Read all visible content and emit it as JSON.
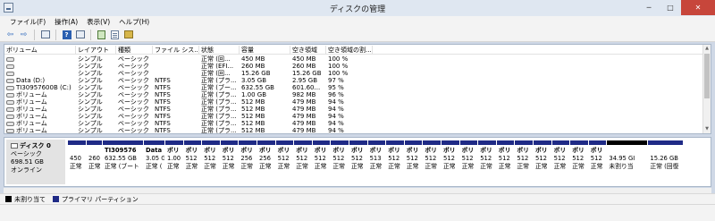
{
  "window": {
    "title": "ディスクの管理",
    "minimize": "─",
    "maximize": "□",
    "close": "✕"
  },
  "menu": [
    "ファイル(F)",
    "操作(A)",
    "表示(V)",
    "ヘルプ(H)"
  ],
  "toolbar": {
    "back": "⇦",
    "forward": "⇨"
  },
  "columns": [
    "ボリューム",
    "レイアウト",
    "種類",
    "ファイル シス...",
    "状態",
    "容量",
    "空き領域",
    "空き領域の割..."
  ],
  "volumes": [
    [
      "",
      "シンプル",
      "ベーシック",
      "",
      "正常 (回...",
      "450 MB",
      "450 MB",
      "100 %"
    ],
    [
      "",
      "シンプル",
      "ベーシック",
      "",
      "正常 (EFI...",
      "260 MB",
      "260 MB",
      "100 %"
    ],
    [
      "",
      "シンプル",
      "ベーシック",
      "",
      "正常 (回...",
      "15.26 GB",
      "15.26 GB",
      "100 %"
    ],
    [
      "Data (D:)",
      "シンプル",
      "ベーシック",
      "NTFS",
      "正常 (プラ...",
      "3.05 GB",
      "2.95 GB",
      "97 %"
    ],
    [
      "TI30957600B (C:)",
      "シンプル",
      "ベーシック",
      "NTFS",
      "正常 (ブー...",
      "632.55 GB",
      "601.60...",
      "95 %"
    ],
    [
      "ボリューム",
      "シンプル",
      "ベーシック",
      "NTFS",
      "正常 (プラ...",
      "1.00 GB",
      "982 MB",
      "96 %"
    ],
    [
      "ボリューム",
      "シンプル",
      "ベーシック",
      "NTFS",
      "正常 (プラ...",
      "512 MB",
      "479 MB",
      "94 %"
    ],
    [
      "ボリューム",
      "シンプル",
      "ベーシック",
      "NTFS",
      "正常 (プラ...",
      "512 MB",
      "479 MB",
      "94 %"
    ],
    [
      "ボリューム",
      "シンプル",
      "ベーシック",
      "NTFS",
      "正常 (プラ...",
      "512 MB",
      "479 MB",
      "94 %"
    ],
    [
      "ボリューム",
      "シンプル",
      "ベーシック",
      "NTFS",
      "正常 (プラ...",
      "512 MB",
      "479 MB",
      "94 %"
    ],
    [
      "ボリューム",
      "シンプル",
      "ベーシック",
      "NTFS",
      "正常 (プラ...",
      "512 MB",
      "479 MB",
      "94 %"
    ]
  ],
  "disk": {
    "name": "ディスク 0",
    "type": "ベーシック",
    "size": "698.51 GB",
    "status": "オンライン",
    "partitions": [
      {
        "name": "",
        "size": "450",
        "status": "正常"
      },
      {
        "name": "",
        "size": "260",
        "status": "正常"
      },
      {
        "name": "TI309576",
        "size": "632.55 GB",
        "status": "正常 (ブート"
      },
      {
        "name": "Data",
        "size": "3.05 G",
        "status": "正常 ("
      },
      {
        "name": "ボリ",
        "size": "1.00",
        "status": "正常"
      },
      {
        "name": "ボリ",
        "size": "512",
        "status": "正常"
      },
      {
        "name": "ボリ",
        "size": "512",
        "status": "正常"
      },
      {
        "name": "ボリ",
        "size": "512",
        "status": "正常"
      },
      {
        "name": "ボリ",
        "size": "256",
        "status": "正常"
      },
      {
        "name": "ボリ",
        "size": "256",
        "status": "正常"
      },
      {
        "name": "ボリ",
        "size": "512",
        "status": "正常"
      },
      {
        "name": "ボリ",
        "size": "512",
        "status": "正常"
      },
      {
        "name": "ボリ",
        "size": "512",
        "status": "正常"
      },
      {
        "name": "ボリ",
        "size": "512",
        "status": "正常"
      },
      {
        "name": "ボリ",
        "size": "512",
        "status": "正常"
      },
      {
        "name": "ボリ",
        "size": "513",
        "status": "正常"
      },
      {
        "name": "ボリ",
        "size": "512",
        "status": "正常"
      },
      {
        "name": "ボリ",
        "size": "512",
        "status": "正常"
      },
      {
        "name": "ボリ",
        "size": "512",
        "status": "正常"
      },
      {
        "name": "ボリ",
        "size": "512",
        "status": "正常"
      },
      {
        "name": "ボリ",
        "size": "512",
        "status": "正常"
      },
      {
        "name": "ボリ",
        "size": "512",
        "status": "正常"
      },
      {
        "name": "ボリ",
        "size": "512",
        "status": "正常"
      },
      {
        "name": "ボリ",
        "size": "512",
        "status": "正常"
      },
      {
        "name": "ボリ",
        "size": "512",
        "status": "正常"
      },
      {
        "name": "ボリ",
        "size": "512",
        "status": "正常"
      },
      {
        "name": "ボリ",
        "size": "512",
        "status": "正常"
      },
      {
        "name": "ボリ",
        "size": "512",
        "status": "正常"
      },
      {
        "name": "",
        "size": "34.95 GI",
        "status": "未割り当",
        "unallocated": true
      },
      {
        "name": "",
        "size": "15.26 GB",
        "status": "正常 (回復"
      }
    ]
  },
  "legend": [
    {
      "label": "未割り当て",
      "color": "#000000"
    },
    {
      "label": "プライマリ パーティション",
      "color": "#1f2a86"
    }
  ],
  "colors": {
    "primary_partition": "#1f2a86",
    "unallocated": "#000000",
    "close_button": "#c7463b"
  }
}
